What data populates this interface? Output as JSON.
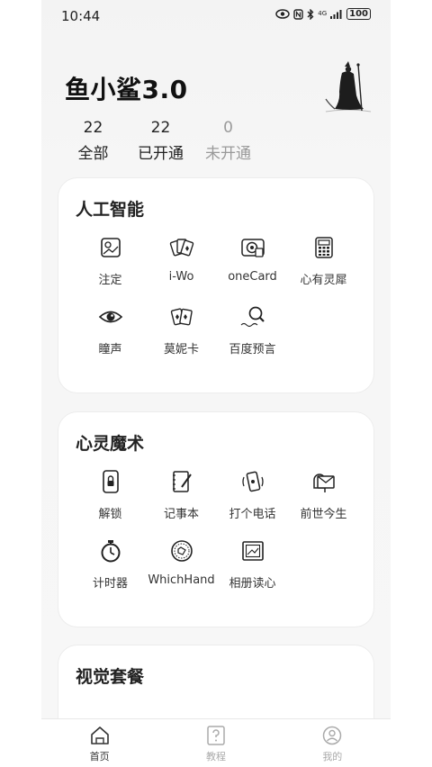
{
  "status_bar": {
    "time": "10:44",
    "network": "4G",
    "battery": "100"
  },
  "header": {
    "app_title": "鱼小鲨3.0"
  },
  "stats": [
    {
      "count": "22",
      "label": "全部"
    },
    {
      "count": "22",
      "label": "已开通"
    },
    {
      "count": "0",
      "label": "未开通"
    }
  ],
  "sections": [
    {
      "title": "人工智能",
      "items": [
        {
          "label": "注定",
          "icon": "photo-frame-icon"
        },
        {
          "label": "i-Wo",
          "icon": "playing-cards-icon"
        },
        {
          "label": "oneCard",
          "icon": "camera-card-icon"
        },
        {
          "label": "心有灵犀",
          "icon": "calculator-icon"
        },
        {
          "label": "瞳声",
          "icon": "eye-icon"
        },
        {
          "label": "莫妮卡",
          "icon": "cards-hand-icon"
        },
        {
          "label": "百度预言",
          "icon": "search-magnifier-icon"
        }
      ]
    },
    {
      "title": "心灵魔术",
      "items": [
        {
          "label": "解锁",
          "icon": "lock-phone-icon"
        },
        {
          "label": "记事本",
          "icon": "notebook-icon"
        },
        {
          "label": "打个电话",
          "icon": "phone-call-icon"
        },
        {
          "label": "前世今生",
          "icon": "mailbox-icon"
        },
        {
          "label": "计时器",
          "icon": "stopwatch-icon"
        },
        {
          "label": "WhichHand",
          "icon": "coin-icon"
        },
        {
          "label": "相册读心",
          "icon": "photo-album-icon"
        }
      ]
    },
    {
      "title": "视觉套餐",
      "items": []
    }
  ],
  "bottom_nav": [
    {
      "label": "首页",
      "icon": "home-icon",
      "active": true
    },
    {
      "label": "教程",
      "icon": "tutorial-icon",
      "active": false
    },
    {
      "label": "我的",
      "icon": "profile-icon",
      "active": false
    }
  ]
}
